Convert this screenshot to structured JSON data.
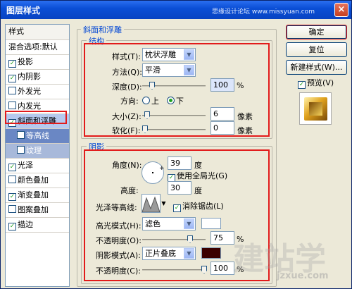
{
  "window": {
    "title": "图层样式",
    "site_watermark": "思缘设计论坛 www.missyuan.com",
    "close": "×"
  },
  "left_panel": {
    "header": "样式",
    "items": [
      {
        "label": "混合选项:默认",
        "checkbox": false,
        "checked": false
      },
      {
        "label": "投影",
        "checkbox": true,
        "checked": true
      },
      {
        "label": "内阴影",
        "checkbox": true,
        "checked": true
      },
      {
        "label": "外发光",
        "checkbox": true,
        "checked": false
      },
      {
        "label": "内发光",
        "checkbox": true,
        "checked": false
      },
      {
        "label": "斜面和浮雕",
        "checkbox": true,
        "checked": true
      },
      {
        "label": "等高线",
        "checkbox": true,
        "checked": false
      },
      {
        "label": "纹理",
        "checkbox": true,
        "checked": false
      },
      {
        "label": "光泽",
        "checkbox": true,
        "checked": true
      },
      {
        "label": "颜色叠加",
        "checkbox": true,
        "checked": false
      },
      {
        "label": "渐变叠加",
        "checkbox": true,
        "checked": true
      },
      {
        "label": "图案叠加",
        "checkbox": true,
        "checked": false
      },
      {
        "label": "描边",
        "checkbox": true,
        "checked": true
      }
    ]
  },
  "bevel": {
    "group_title": "斜面和浮雕",
    "structure": {
      "title": "结构",
      "style_label": "样式(T):",
      "style_value": "枕状浮雕",
      "technique_label": "方法(Q):",
      "technique_value": "平滑",
      "depth_label": "深度(D):",
      "depth_value": "100",
      "depth_unit": "%",
      "direction_label": "方向:",
      "dir_up": "上",
      "dir_down": "下",
      "size_label": "大小(Z):",
      "size_value": "6",
      "size_unit": "像素",
      "soften_label": "软化(F):",
      "soften_value": "0",
      "soften_unit": "像素"
    },
    "shading": {
      "title": "阴影",
      "angle_label": "角度(N):",
      "angle_value": "39",
      "angle_unit": "度",
      "global_light_label": "使用全局光(G)",
      "altitude_label": "高度:",
      "altitude_value": "30",
      "altitude_unit": "度",
      "gloss_label": "光泽等高线:",
      "antialias_label": "消除锯齿(L)",
      "highlight_mode_label": "高光模式(H):",
      "highlight_mode_value": "滤色",
      "highlight_opacity_label": "不透明度(O):",
      "highlight_opacity_value": "75",
      "highlight_opacity_unit": "%",
      "shadow_mode_label": "阴影模式(A):",
      "shadow_mode_value": "正片叠底",
      "shadow_opacity_label": "不透明度(C):",
      "shadow_opacity_value": "100",
      "shadow_opacity_unit": "%",
      "highlight_color": "#ffffff",
      "shadow_color": "#3b0000"
    }
  },
  "right": {
    "ok": "确定",
    "reset": "复位",
    "new_style": "新建样式(W)...",
    "preview": "预览(V)"
  },
  "colors": {
    "accent_red": "#e21b1b",
    "title_blue": "#0b4fd6",
    "preview_gold": "#e0a21d"
  },
  "watermark": {
    "big": "建站学",
    "small": "jzxue.com"
  }
}
